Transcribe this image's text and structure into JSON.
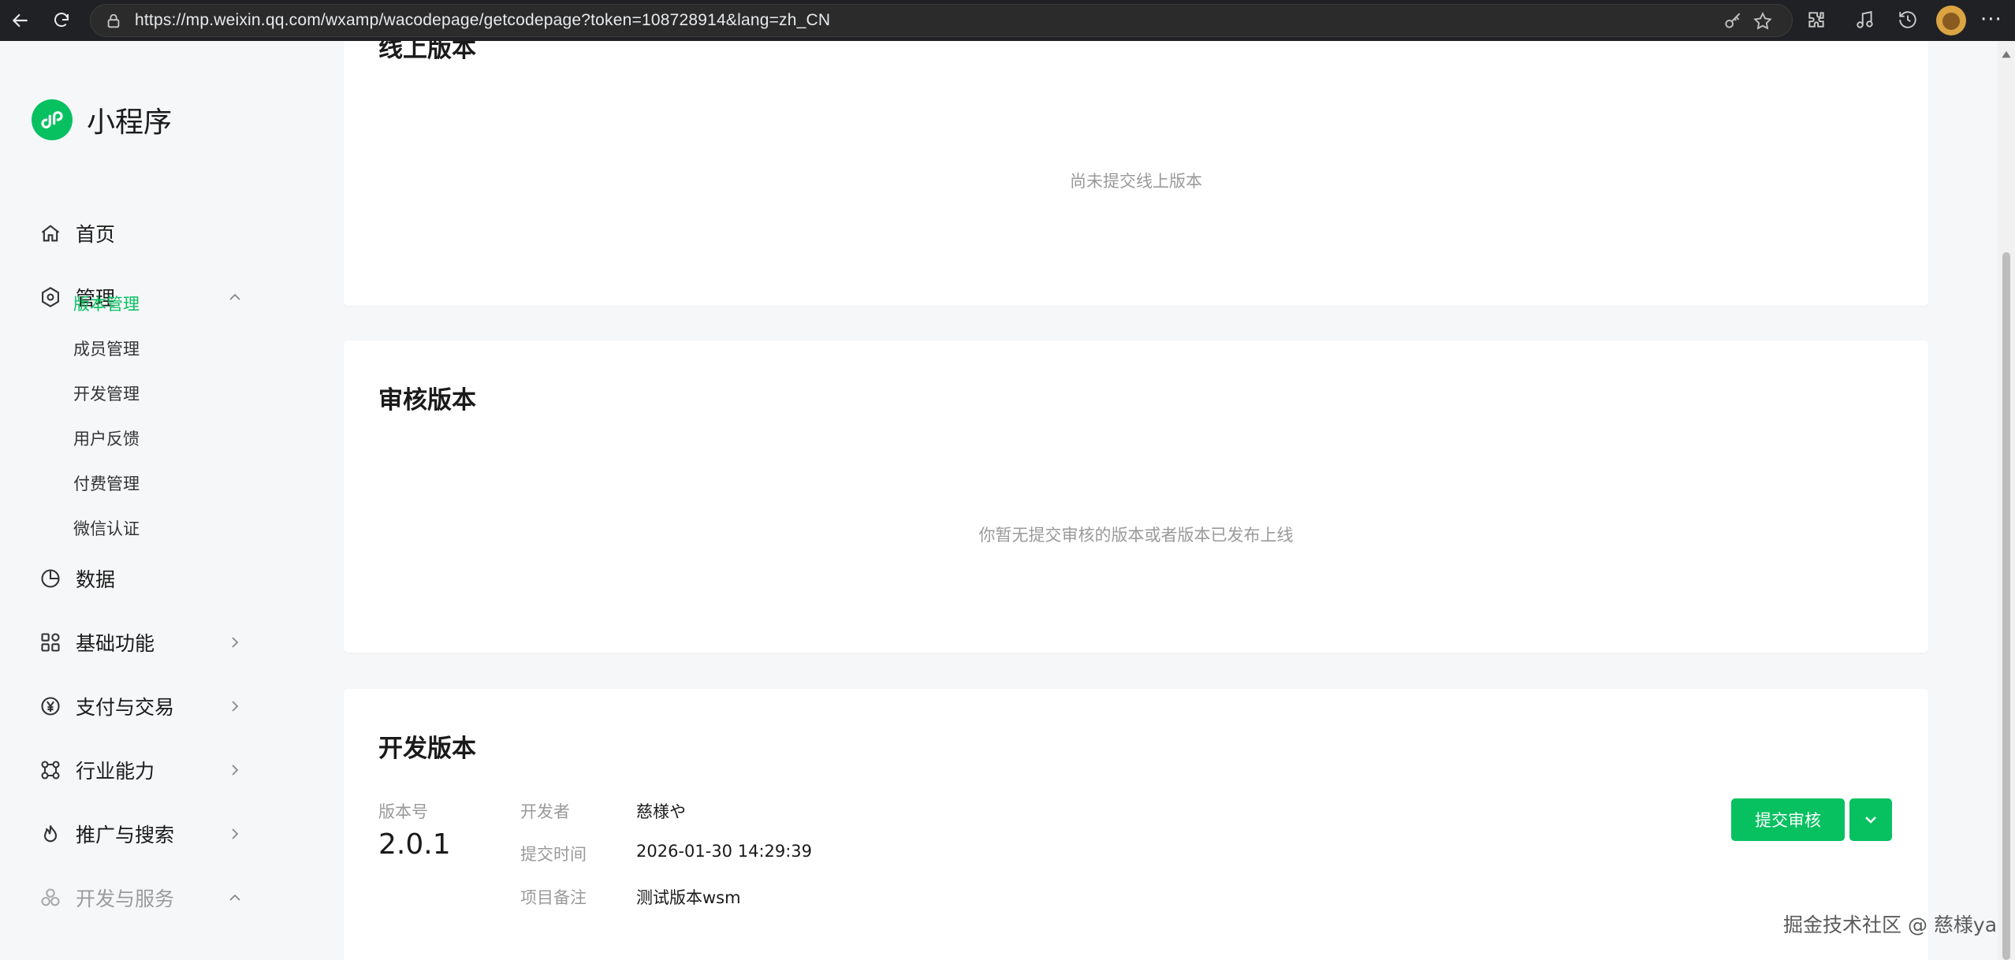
{
  "browser": {
    "url": "https://mp.weixin.qq.com/wxamp/wacodepage/getcodepage?token=108728914&lang=zh_CN",
    "more_label": "···"
  },
  "sidebar": {
    "logo_text": "小程序",
    "items": [
      {
        "label": "首页",
        "icon": "home-icon"
      },
      {
        "label": "管理",
        "icon": "hexagon-settings-icon",
        "expanded": true
      },
      {
        "label": "数据",
        "icon": "pie-chart-icon"
      },
      {
        "label": "基础功能",
        "icon": "grid-icon"
      },
      {
        "label": "支付与交易",
        "icon": "yen-icon"
      },
      {
        "label": "行业能力",
        "icon": "nodes-icon"
      },
      {
        "label": "推广与搜索",
        "icon": "flame-icon"
      },
      {
        "label": "开发与服务",
        "icon": "cluster-icon"
      }
    ],
    "sub_items": [
      "版本管理",
      "成员管理",
      "开发管理",
      "用户反馈",
      "付费管理",
      "微信认证"
    ],
    "active_sub": "版本管理"
  },
  "online_card": {
    "title": "线上版本",
    "empty_text": "尚未提交线上版本"
  },
  "review_card": {
    "title": "审核版本",
    "empty_text": "你暂无提交审核的版本或者版本已发布上线"
  },
  "dev_card": {
    "title": "开发版本",
    "version_label": "版本号",
    "version_value": "2.0.1",
    "developer_label": "开发者",
    "developer_value": "慈様や",
    "submit_time_label": "提交时间",
    "submit_time_value": "2026-01-30 14:29:39",
    "remark_label": "项目备注",
    "remark_value": "测试版本wsm",
    "submit_button": "提交审核"
  },
  "watermark": "掘金技术社区 @ 慈様ya",
  "colors": {
    "accent": "#07c160",
    "page_bg": "#f6f7f9",
    "card_bg": "#ffffff",
    "muted_text": "#9a9a9a"
  }
}
